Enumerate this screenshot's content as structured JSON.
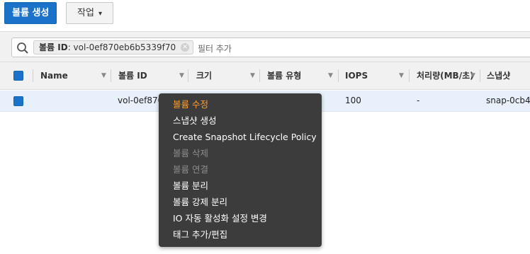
{
  "toolbar": {
    "create_volume_label": "볼륨 생성",
    "actions_label": "작업"
  },
  "filter": {
    "token_key": "볼륨 ID",
    "token_value": ": vol-0ef870eb6b5339f70",
    "placeholder": "필터 추가"
  },
  "table": {
    "columns": [
      "Name",
      "볼륨 ID",
      "크기",
      "볼륨 유형",
      "IOPS",
      "처리량(MB/초)",
      "스냅샷"
    ],
    "rows": [
      {
        "name": "",
        "volume_id": "vol-0ef870",
        "size": "",
        "type": "",
        "iops": "100",
        "throughput": "-",
        "snapshot": "snap-0cb4"
      }
    ]
  },
  "context_menu": {
    "items": [
      {
        "label": "볼륨 수정",
        "state": "active"
      },
      {
        "label": "스냅샷 생성",
        "state": "enabled"
      },
      {
        "label": "Create Snapshot Lifecycle Policy",
        "state": "enabled"
      },
      {
        "label": "볼륨 삭제",
        "state": "disabled"
      },
      {
        "label": "볼륨 연결",
        "state": "disabled"
      },
      {
        "label": "볼륨 분리",
        "state": "enabled"
      },
      {
        "label": "볼륨 강제 분리",
        "state": "enabled"
      },
      {
        "label": "IO 자동 활성화 설정 변경",
        "state": "enabled"
      },
      {
        "label": "태그 추가/편집",
        "state": "enabled"
      }
    ]
  },
  "colors": {
    "primary": "#1a73c8",
    "menu_bg": "#3c3c3c",
    "menu_active": "#ff9f2e",
    "row_selected": "#e8f1fb"
  },
  "icons": [
    "search-icon",
    "close-icon",
    "chevron-down-icon",
    "sort-icon"
  ]
}
